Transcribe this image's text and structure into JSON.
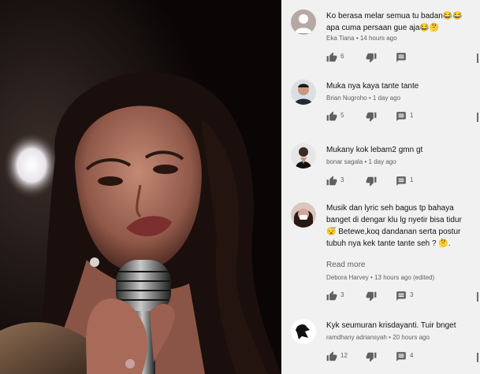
{
  "comments": [
    {
      "text": "Ko berasa melar semua tu badan😂😂apa cuma persaan gue aja😂🤔",
      "author": "Eka Tiana",
      "time": "14 hours ago",
      "likes": "6",
      "replies": ""
    },
    {
      "text": "Muka nya kaya tante tante",
      "author": "Brian Nugroho",
      "time": "1 day ago",
      "likes": "5",
      "replies": "1"
    },
    {
      "text": "Mukany kok lebam2 gmn gt",
      "author": "bonar sagala",
      "time": "1 day ago",
      "likes": "3",
      "replies": "1"
    },
    {
      "text": "Musik dan lyric seh bagus tp bahaya banget di dengar klu lg nyetir bisa tidur 😴 Betewe,koq dandanan serta postur tubuh nya kek tante tante seh ? 🤔. Melar kmna mana. Wajah dan dandanan lbh tua dr usia",
      "more": "Read more",
      "author": "Debora Harvey",
      "time": "13 hours ago (edited)",
      "likes": "3",
      "replies": "3"
    },
    {
      "text": "Kyk seumuran krisdayanti. Tuir bnget",
      "author": "ramdhany adriansyah",
      "time": "20 hours ago",
      "likes": "12",
      "replies": "4"
    }
  ],
  "meta_separator": "•"
}
